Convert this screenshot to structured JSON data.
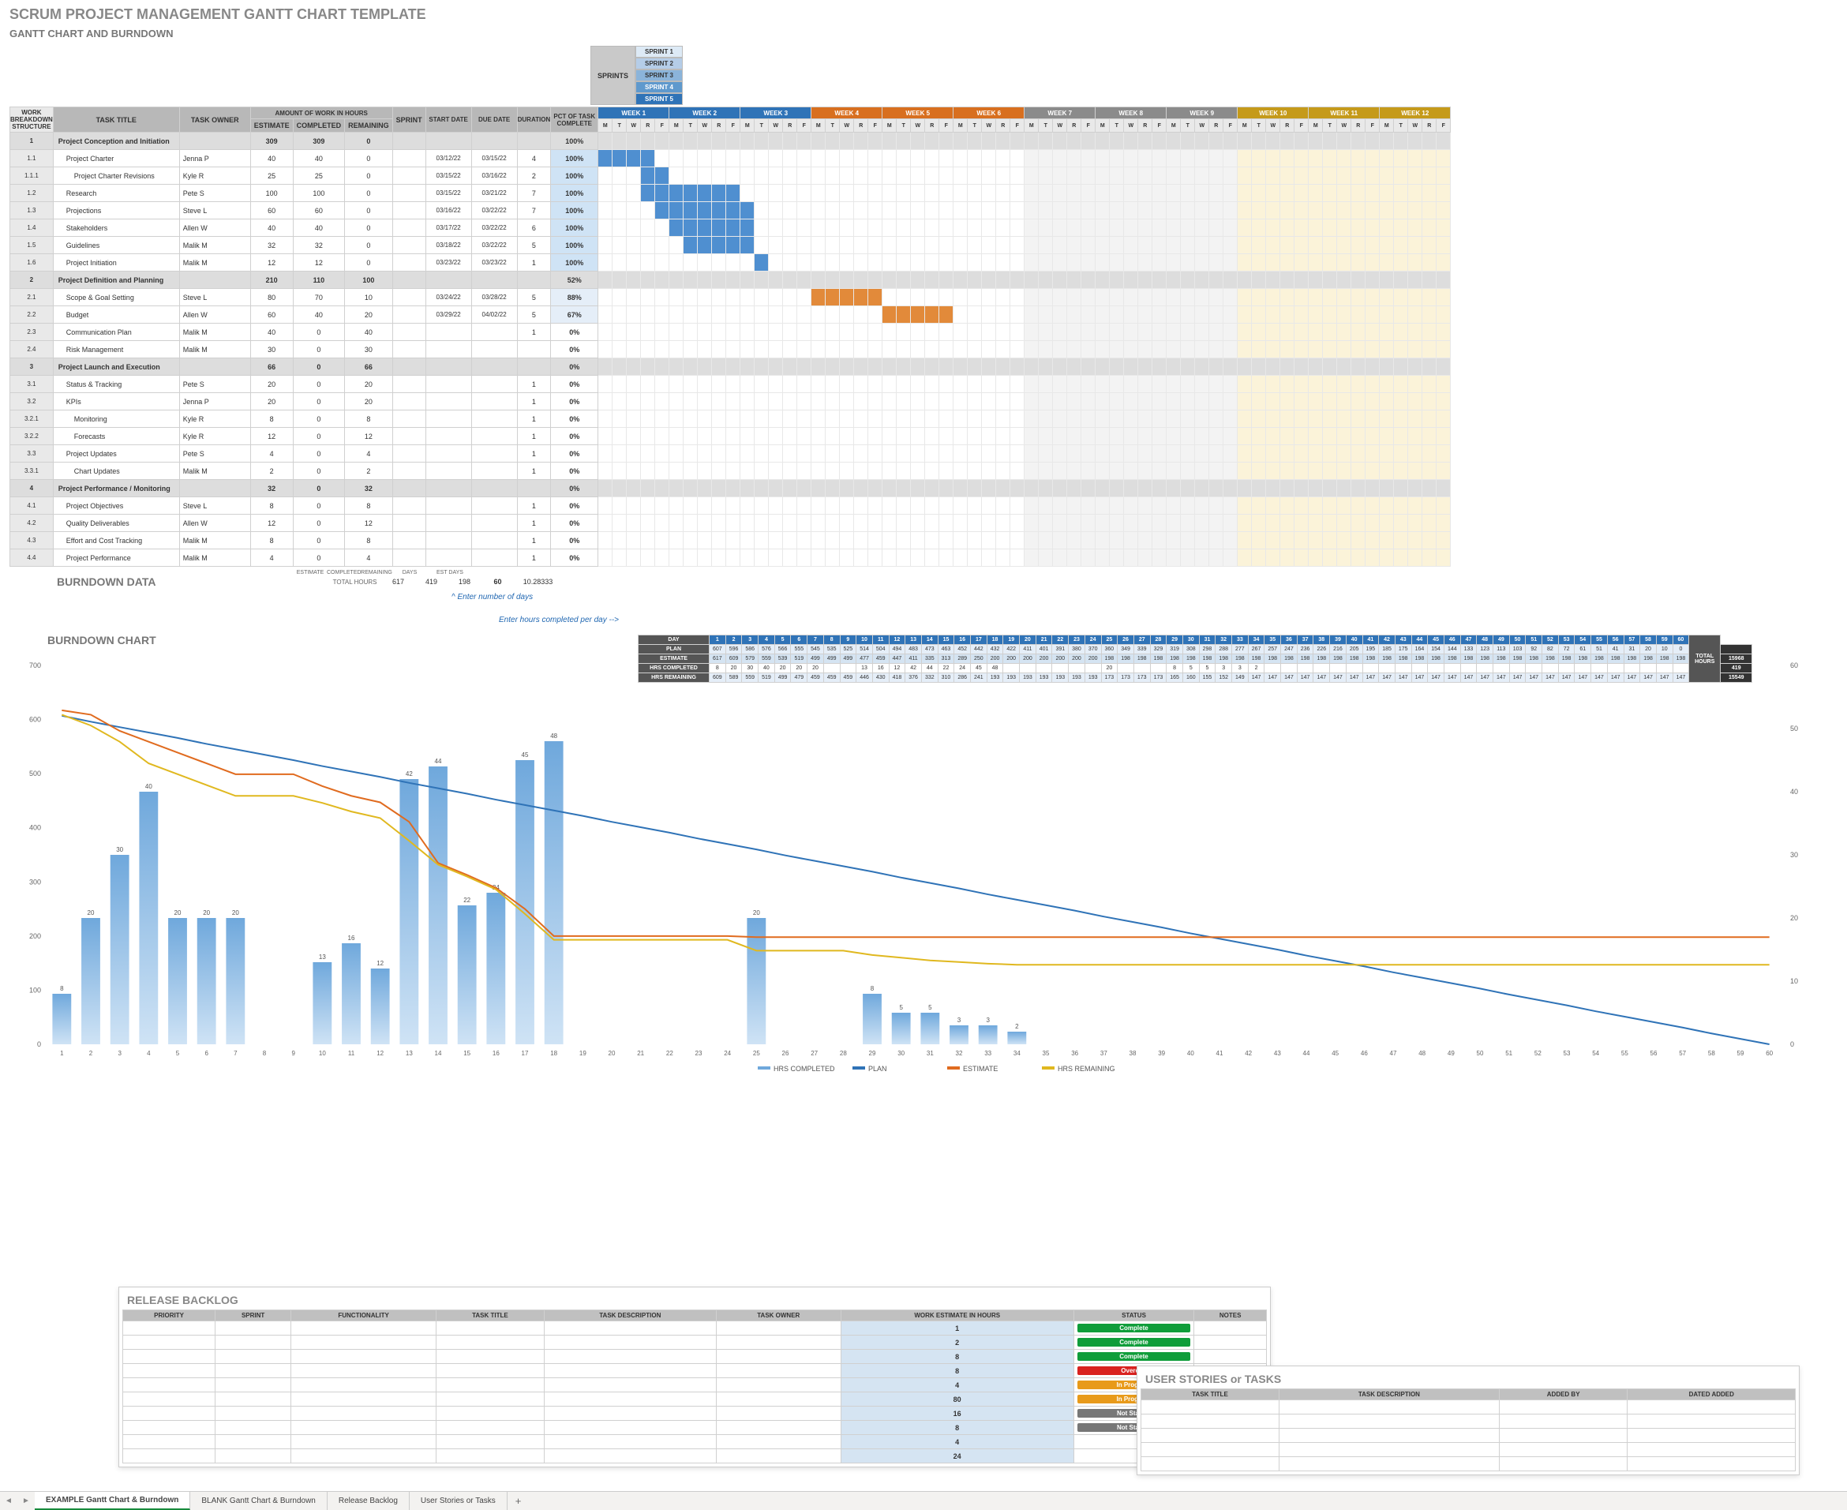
{
  "titles": {
    "main": "SCRUM PROJECT MANAGEMENT GANTT CHART TEMPLATE",
    "sub": "GANTT CHART AND BURNDOWN",
    "burndown_data": "BURNDOWN DATA",
    "burndown_chart": "BURNDOWN CHART",
    "release_backlog": "RELEASE BACKLOG",
    "user_stories": "USER STORIES or TASKS"
  },
  "sprintsLabel": "SPRINTS",
  "sprints": [
    "SPRINT 1",
    "SPRINT 2",
    "SPRINT 3",
    "SPRINT 4",
    "SPRINT 5"
  ],
  "sprintSpans": [
    [
      1,
      15
    ],
    [
      16,
      30
    ],
    [
      31,
      45
    ],
    [
      46,
      55
    ],
    [
      46,
      60
    ]
  ],
  "headers": {
    "wbs": "WORK BREAKDOWN STRUCTURE",
    "task": "TASK TITLE",
    "owner": "TASK OWNER",
    "amount": "AMOUNT OF WORK IN HOURS",
    "est": "ESTIMATE",
    "comp": "COMPLETED",
    "rem": "REMAINING",
    "sprint": "SPRINT",
    "start": "START DATE",
    "due": "DUE DATE",
    "dur": "DURATION",
    "pct": "PCT OF TASK COMPLETE"
  },
  "weekColors": [
    "wkBlue",
    "wkBlue",
    "wkBlue",
    "wkOrange",
    "wkOrange",
    "wkOrange",
    "wkGray",
    "wkGray",
    "wkGray",
    "wkGold",
    "wkGold",
    "wkGold"
  ],
  "weeks": [
    "WEEK 1",
    "WEEK 2",
    "WEEK 3",
    "WEEK 4",
    "WEEK 5",
    "WEEK 6",
    "WEEK 7",
    "WEEK 8",
    "WEEK 9",
    "WEEK 10",
    "WEEK 11",
    "WEEK 12"
  ],
  "dayLetters": [
    "M",
    "T",
    "W",
    "R",
    "F"
  ],
  "tasks": [
    {
      "wbs": "1",
      "title": "Project Conception and Initiation",
      "owner": "",
      "est": 309,
      "comp": 309,
      "rem": 0,
      "sprint": "",
      "start": "",
      "due": "",
      "dur": "",
      "pct": "100%",
      "group": true
    },
    {
      "wbs": "1.1",
      "title": "Project Charter",
      "owner": "Jenna P",
      "est": 40,
      "comp": 40,
      "rem": 0,
      "start": "03/12/22",
      "due": "03/15/22",
      "dur": 4,
      "pct": "100%",
      "bar": [
        1,
        4
      ],
      "color": "barBlue"
    },
    {
      "wbs": "1.1.1",
      "title": "Project Charter Revisions",
      "owner": "Kyle R",
      "est": 25,
      "comp": 25,
      "rem": 0,
      "start": "03/15/22",
      "due": "03/16/22",
      "dur": 2,
      "pct": "100%",
      "bar": [
        4,
        5
      ],
      "color": "barBlue"
    },
    {
      "wbs": "1.2",
      "title": "Research",
      "owner": "Pete S",
      "est": 100,
      "comp": 100,
      "rem": 0,
      "start": "03/15/22",
      "due": "03/21/22",
      "dur": 7,
      "pct": "100%",
      "bar": [
        4,
        10
      ],
      "color": "barBlue"
    },
    {
      "wbs": "1.3",
      "title": "Projections",
      "owner": "Steve L",
      "est": 60,
      "comp": 60,
      "rem": 0,
      "start": "03/16/22",
      "due": "03/22/22",
      "dur": 7,
      "pct": "100%",
      "bar": [
        5,
        11
      ],
      "color": "barBlue"
    },
    {
      "wbs": "1.4",
      "title": "Stakeholders",
      "owner": "Allen W",
      "est": 40,
      "comp": 40,
      "rem": 0,
      "start": "03/17/22",
      "due": "03/22/22",
      "dur": 6,
      "pct": "100%",
      "bar": [
        6,
        11
      ],
      "color": "barBlue"
    },
    {
      "wbs": "1.5",
      "title": "Guidelines",
      "owner": "Malik M",
      "est": 32,
      "comp": 32,
      "rem": 0,
      "start": "03/18/22",
      "due": "03/22/22",
      "dur": 5,
      "pct": "100%",
      "bar": [
        7,
        11
      ],
      "color": "barBlue"
    },
    {
      "wbs": "1.6",
      "title": "Project Initiation",
      "owner": "Malik M",
      "est": 12,
      "comp": 12,
      "rem": 0,
      "start": "03/23/22",
      "due": "03/23/22",
      "dur": 1,
      "pct": "100%",
      "bar": [
        12,
        12
      ],
      "color": "barBlue"
    },
    {
      "wbs": "2",
      "title": "Project Definition and Planning",
      "owner": "",
      "est": 210,
      "comp": 110,
      "rem": 100,
      "pct": "52%",
      "group": true
    },
    {
      "wbs": "2.1",
      "title": "Scope & Goal Setting",
      "owner": "Steve L",
      "est": 80,
      "comp": 70,
      "rem": 10,
      "start": "03/24/22",
      "due": "03/28/22",
      "dur": 5,
      "pct": "88%",
      "bar": [
        16,
        20
      ],
      "color": "barOr"
    },
    {
      "wbs": "2.2",
      "title": "Budget",
      "owner": "Allen W",
      "est": 60,
      "comp": 40,
      "rem": 20,
      "start": "03/29/22",
      "due": "04/02/22",
      "dur": 5,
      "pct": "67%",
      "bar": [
        21,
        25
      ],
      "color": "barOr"
    },
    {
      "wbs": "2.3",
      "title": "Communication Plan",
      "owner": "Malik M",
      "est": 40,
      "comp": 0,
      "rem": 40,
      "dur": 1,
      "pct": "0%"
    },
    {
      "wbs": "2.4",
      "title": "Risk Management",
      "owner": "Malik M",
      "est": 30,
      "comp": 0,
      "rem": 30,
      "dur": "",
      "pct": "0%"
    },
    {
      "wbs": "3",
      "title": "Project Launch and Execution",
      "owner": "",
      "est": 66,
      "comp": 0,
      "rem": 66,
      "pct": "0%",
      "group": true
    },
    {
      "wbs": "3.1",
      "title": "Status & Tracking",
      "owner": "Pete S",
      "est": 20,
      "comp": 0,
      "rem": 20,
      "dur": 1,
      "pct": "0%"
    },
    {
      "wbs": "3.2",
      "title": "KPIs",
      "owner": "Jenna P",
      "est": 20,
      "comp": 0,
      "rem": 20,
      "dur": 1,
      "pct": "0%"
    },
    {
      "wbs": "3.2.1",
      "title": "Monitoring",
      "owner": "Kyle R",
      "est": 8,
      "comp": 0,
      "rem": 8,
      "dur": 1,
      "pct": "0%"
    },
    {
      "wbs": "3.2.2",
      "title": "Forecasts",
      "owner": "Kyle R",
      "est": 12,
      "comp": 0,
      "rem": 12,
      "dur": 1,
      "pct": "0%"
    },
    {
      "wbs": "3.3",
      "title": "Project Updates",
      "owner": "Pete S",
      "est": 4,
      "comp": 0,
      "rem": 4,
      "dur": 1,
      "pct": "0%"
    },
    {
      "wbs": "3.3.1",
      "title": "Chart Updates",
      "owner": "Malik M",
      "est": 2,
      "comp": 0,
      "rem": 2,
      "dur": 1,
      "pct": "0%"
    },
    {
      "wbs": "4",
      "title": "Project Performance / Monitoring",
      "owner": "",
      "est": 32,
      "comp": 0,
      "rem": 32,
      "pct": "0%",
      "group": true
    },
    {
      "wbs": "4.1",
      "title": "Project Objectives",
      "owner": "Steve L",
      "est": 8,
      "comp": 0,
      "rem": 8,
      "dur": 1,
      "pct": "0%"
    },
    {
      "wbs": "4.2",
      "title": "Quality Deliverables",
      "owner": "Allen W",
      "est": 12,
      "comp": 0,
      "rem": 12,
      "dur": 1,
      "pct": "0%"
    },
    {
      "wbs": "4.3",
      "title": "Effort and Cost Tracking",
      "owner": "Malik M",
      "est": 8,
      "comp": 0,
      "rem": 8,
      "dur": 1,
      "pct": "0%"
    },
    {
      "wbs": "4.4",
      "title": "Project Performance",
      "owner": "Malik M",
      "est": 4,
      "comp": 0,
      "rem": 4,
      "dur": 1,
      "pct": "0%"
    }
  ],
  "totals": {
    "label": "TOTAL HOURS",
    "est": 617,
    "comp": 419,
    "rem": 198,
    "days": 60,
    "estdays": "10.28333",
    "colLabels": [
      "ESTIMATE",
      "COMPLETED",
      "REMAINING",
      "DAYS",
      "EST DAYS"
    ]
  },
  "hints": {
    "enterDays": "^ Enter number of days",
    "enterHours": "Enter hours completed per day -->"
  },
  "burndownTable": {
    "dayLabel": "DAY",
    "rowLabels": [
      "PLAN",
      "ESTIMATE",
      "HRS COMPLETED",
      "HRS REMAINING"
    ],
    "totalLabel": "TOTAL HOURS",
    "totals": [
      "",
      "15968",
      "419",
      "15549"
    ],
    "days": 60,
    "plan": [
      607,
      596,
      586,
      576,
      566,
      555,
      545,
      535,
      525,
      514,
      504,
      494,
      483,
      473,
      463,
      452,
      442,
      432,
      422,
      411,
      401,
      391,
      380,
      370,
      360,
      349,
      339,
      329,
      319,
      308,
      298,
      288,
      277,
      267,
      257,
      247,
      236,
      226,
      216,
      205,
      195,
      185,
      175,
      164,
      154,
      144,
      133,
      123,
      113,
      103,
      92,
      82,
      72,
      61,
      51,
      41,
      31,
      20,
      10,
      0
    ],
    "estimate": [
      617,
      609,
      579,
      559,
      539,
      519,
      499,
      499,
      499,
      477,
      459,
      447,
      411,
      335,
      313,
      289,
      250,
      200,
      200,
      200,
      200,
      200,
      200,
      200,
      198,
      198,
      198,
      198,
      198,
      198,
      198,
      198,
      198,
      198,
      198,
      198,
      198,
      198,
      198,
      198,
      198,
      198,
      198,
      198,
      198,
      198,
      198,
      198,
      198,
      198,
      198,
      198,
      198,
      198,
      198,
      198,
      198,
      198,
      198,
      198
    ],
    "hrsCompleted": [
      8,
      20,
      30,
      40,
      20,
      20,
      20,
      "",
      "",
      13,
      16,
      12,
      42,
      44,
      22,
      24,
      45,
      48,
      "",
      "",
      "",
      "",
      "",
      "",
      20,
      "",
      "",
      "",
      8,
      5,
      5,
      3,
      3,
      2,
      "",
      "",
      "",
      "",
      "",
      "",
      "",
      "",
      "",
      "",
      "",
      "",
      "",
      "",
      "",
      "",
      "",
      "",
      "",
      "",
      "",
      "",
      "",
      "",
      "",
      ""
    ],
    "hrsRemaining": [
      609,
      589,
      559,
      519,
      499,
      479,
      459,
      459,
      459,
      446,
      430,
      418,
      376,
      332,
      310,
      286,
      241,
      193,
      193,
      193,
      193,
      193,
      193,
      193,
      173,
      173,
      173,
      173,
      165,
      160,
      155,
      152,
      149,
      147,
      147,
      147,
      147,
      147,
      147,
      147,
      147,
      147,
      147,
      147,
      147,
      147,
      147,
      147,
      147,
      147,
      147,
      147,
      147,
      147,
      147,
      147,
      147,
      147,
      147,
      147
    ]
  },
  "chart_data": {
    "type": "combo",
    "title": "",
    "x": [
      1,
      2,
      3,
      4,
      5,
      6,
      7,
      8,
      9,
      10,
      11,
      12,
      13,
      14,
      15,
      16,
      17,
      18,
      19,
      20,
      21,
      22,
      23,
      24,
      25,
      26,
      27,
      28,
      29,
      30,
      31,
      32,
      33,
      34,
      35,
      36,
      37,
      38,
      39,
      40,
      41,
      42,
      43,
      44,
      45,
      46,
      47,
      48,
      49,
      50,
      51,
      52,
      53,
      54,
      55,
      56,
      57,
      58,
      59,
      60
    ],
    "y1_label_left": "",
    "y1_range": [
      0,
      700
    ],
    "y2_label_right": "",
    "y2_range": [
      0,
      60
    ],
    "series": [
      {
        "name": "HRS COMPLETED",
        "type": "bar",
        "axis": "right",
        "values": [
          8,
          20,
          30,
          40,
          20,
          20,
          20,
          0,
          0,
          13,
          16,
          12,
          42,
          44,
          22,
          24,
          45,
          48,
          0,
          0,
          0,
          0,
          0,
          0,
          20,
          0,
          0,
          0,
          8,
          5,
          5,
          3,
          3,
          2,
          0,
          0,
          0,
          0,
          0,
          0,
          0,
          0,
          0,
          0,
          0,
          0,
          0,
          0,
          0,
          0,
          0,
          0,
          0,
          0,
          0,
          0,
          0,
          0,
          0,
          0
        ]
      },
      {
        "name": "PLAN",
        "type": "line",
        "axis": "left",
        "values": [
          607,
          596,
          586,
          576,
          566,
          555,
          545,
          535,
          525,
          514,
          504,
          494,
          483,
          473,
          463,
          452,
          442,
          432,
          422,
          411,
          401,
          391,
          380,
          370,
          360,
          349,
          339,
          329,
          319,
          308,
          298,
          288,
          277,
          267,
          257,
          247,
          236,
          226,
          216,
          205,
          195,
          185,
          175,
          164,
          154,
          144,
          133,
          123,
          113,
          103,
          92,
          82,
          72,
          61,
          51,
          41,
          31,
          20,
          10,
          0
        ]
      },
      {
        "name": "ESTIMATE",
        "type": "line",
        "axis": "left",
        "values": [
          617,
          609,
          579,
          559,
          539,
          519,
          499,
          499,
          499,
          477,
          459,
          447,
          411,
          335,
          313,
          289,
          250,
          200,
          200,
          200,
          200,
          200,
          200,
          200,
          198,
          198,
          198,
          198,
          198,
          198,
          198,
          198,
          198,
          198,
          198,
          198,
          198,
          198,
          198,
          198,
          198,
          198,
          198,
          198,
          198,
          198,
          198,
          198,
          198,
          198,
          198,
          198,
          198,
          198,
          198,
          198,
          198,
          198,
          198,
          198
        ]
      },
      {
        "name": "HRS REMAINING",
        "type": "line",
        "axis": "left",
        "values": [
          609,
          589,
          559,
          519,
          499,
          479,
          459,
          459,
          459,
          446,
          430,
          418,
          376,
          332,
          310,
          286,
          241,
          193,
          193,
          193,
          193,
          193,
          193,
          193,
          173,
          173,
          173,
          173,
          165,
          160,
          155,
          152,
          149,
          147,
          147,
          147,
          147,
          147,
          147,
          147,
          147,
          147,
          147,
          147,
          147,
          147,
          147,
          147,
          147,
          147,
          147,
          147,
          147,
          147,
          147,
          147,
          147,
          147,
          147,
          147
        ]
      }
    ],
    "legend": [
      "HRS COMPLETED",
      "PLAN",
      "ESTIMATE",
      "HRS REMAINING"
    ]
  },
  "backlog": {
    "headers": [
      "PRIORITY",
      "SPRINT",
      "FUNCTIONALITY",
      "TASK TITLE",
      "TASK DESCRIPTION",
      "TASK OWNER",
      "WORK ESTIMATE IN HOURS",
      "STATUS",
      "NOTES"
    ],
    "rows": [
      {
        "est": 1,
        "status": "Complete",
        "cls": "st-complete"
      },
      {
        "est": 2,
        "status": "Complete",
        "cls": "st-complete"
      },
      {
        "est": 8,
        "status": "Complete",
        "cls": "st-complete"
      },
      {
        "est": 8,
        "status": "Overdue",
        "cls": "st-overdue"
      },
      {
        "est": 4,
        "status": "In Progress",
        "cls": "st-progress"
      },
      {
        "est": 80,
        "status": "In Progress",
        "cls": "st-progress"
      },
      {
        "est": 16,
        "status": "Not Started",
        "cls": "st-notstart"
      },
      {
        "est": 8,
        "status": "Not Started",
        "cls": "st-notstart"
      },
      {
        "est": 4,
        "status": "",
        "cls": ""
      },
      {
        "est": 24,
        "status": "",
        "cls": ""
      }
    ]
  },
  "userstory": {
    "headers": [
      "TASK TITLE",
      "TASK DESCRIPTION",
      "ADDED BY",
      "DATED ADDED"
    ]
  },
  "tabs": [
    "EXAMPLE Gantt Chart & Burndown",
    "BLANK Gantt Chart & Burndown",
    "Release Backlog",
    "User Stories or Tasks"
  ]
}
